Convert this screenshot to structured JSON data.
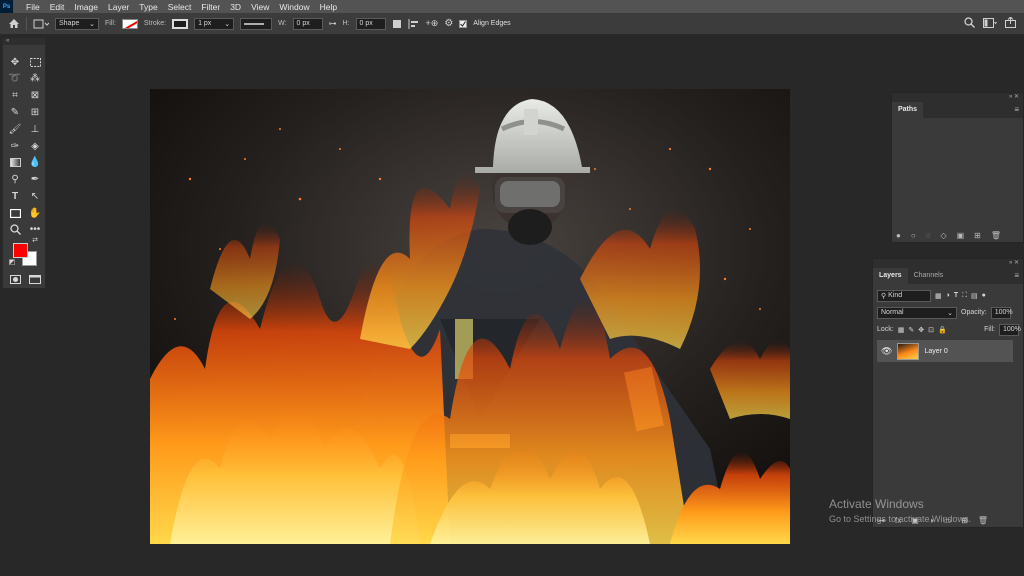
{
  "app": {
    "logo": "Ps"
  },
  "menubar": {
    "items": [
      "File",
      "Edit",
      "Image",
      "Layer",
      "Type",
      "Select",
      "Filter",
      "3D",
      "View",
      "Window",
      "Help"
    ]
  },
  "options": {
    "mode": "Shape",
    "fill_label": "Fill:",
    "stroke_label": "Stroke:",
    "stroke_width": "1 px",
    "w_label": "W:",
    "w_value": "0 px",
    "h_label": "H:",
    "h_value": "0 px",
    "align_edges": "Align Edges"
  },
  "colors": {
    "foreground": "#ff0000",
    "background": "#ffffff"
  },
  "paths_panel": {
    "tab": "Paths"
  },
  "layers_panel": {
    "tabs": [
      "Layers",
      "Channels"
    ],
    "filter_kind": "Kind",
    "blend_mode": "Normal",
    "opacity_label": "Opacity:",
    "opacity_value": "100%",
    "lock_label": "Lock:",
    "fill_label": "Fill:",
    "fill_value": "100%",
    "layer_name": "Layer 0"
  },
  "watermark": {
    "line1": "Activate Windows",
    "line2": "Go to Settings to activate Windows."
  }
}
